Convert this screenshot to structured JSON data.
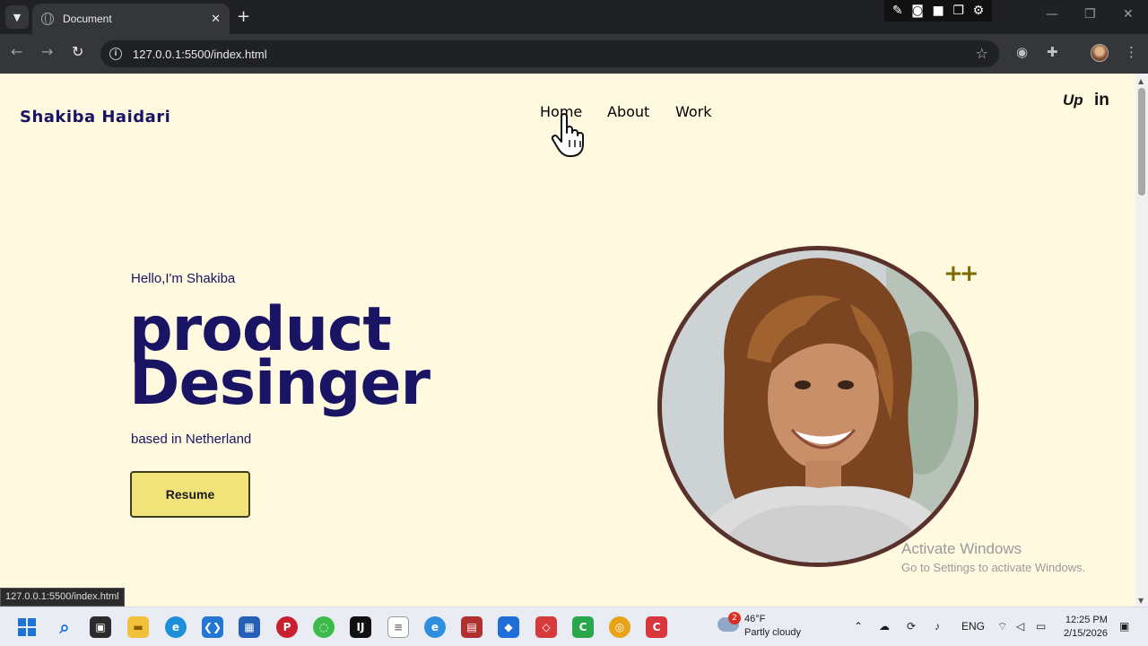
{
  "browser": {
    "tab_title": "Document",
    "url": "127.0.0.1:5500/index.html",
    "status_url": "127.0.0.1:5500/index.html"
  },
  "site": {
    "brand": "Shakiba Haidari",
    "nav": [
      {
        "label": "Home"
      },
      {
        "label": "About"
      },
      {
        "label": "Work"
      }
    ],
    "social": {
      "upwork": "Up",
      "linkedin": "in"
    },
    "hero": {
      "greeting": "Hello,I'm Shakiba",
      "role_line1": "product",
      "role_line2": "Desinger",
      "location": "based in Netherland",
      "button_label": "Resume",
      "decoration": "++"
    },
    "colors": {
      "background": "#fff9e0",
      "text": "#1a1464",
      "button": "#f1e27a",
      "photo_border": "#5a302a"
    }
  },
  "watermark": {
    "line1": "Activate Windows",
    "line2": "Go to Settings to activate Windows."
  },
  "taskbar": {
    "weather_badge": "2",
    "temperature": "46°F",
    "condition": "Partly cloudy",
    "language": "ENG",
    "time": "12:25 PM",
    "date": "2/15/2026"
  }
}
